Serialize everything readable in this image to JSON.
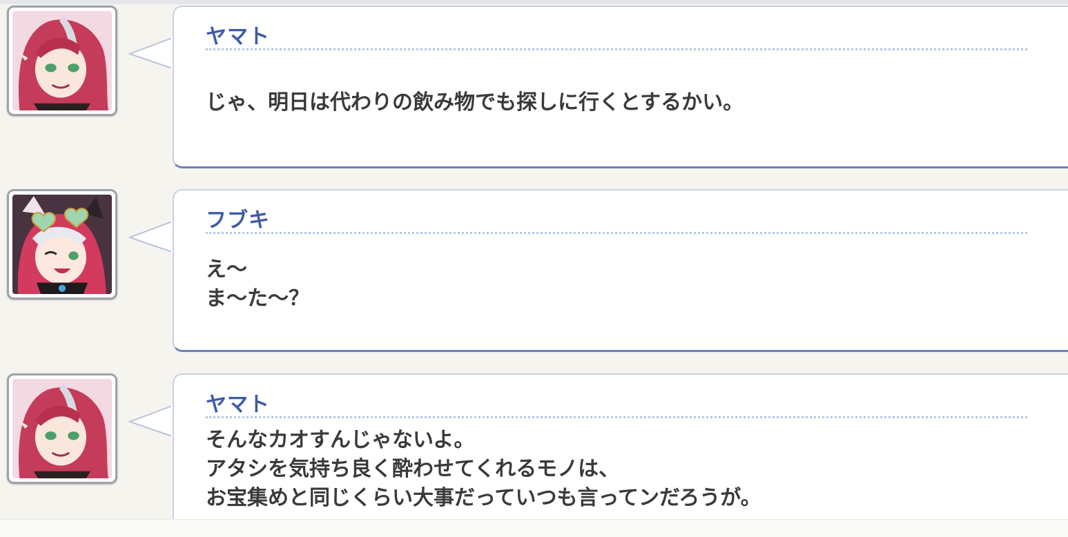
{
  "dialogue": [
    {
      "speaker": "ヤマト",
      "message": "じゃ、明日は代わりの飲み物でも探しに行くとするかい。",
      "avatar_icon": "yamato-portrait-icon"
    },
    {
      "speaker": "フブキ",
      "message": "え～\nま～た～？",
      "avatar_icon": "fubuki-portrait-icon"
    },
    {
      "speaker": "ヤマト",
      "message": "そんなカオすんじゃないよ。\nアタシを気持ち良く酔わせてくれるモノは、\nお宝集めと同じくらい大事だっていつも言ってンだろうが。",
      "avatar_icon": "yamato-portrait-icon"
    }
  ],
  "colors": {
    "speaker_name": "#3f5ba8",
    "message_text": "#3a3a3a",
    "bubble_border_bottom": "#6e7fb6",
    "divider": "#b3c6e6",
    "background": "#f5f4ef"
  }
}
